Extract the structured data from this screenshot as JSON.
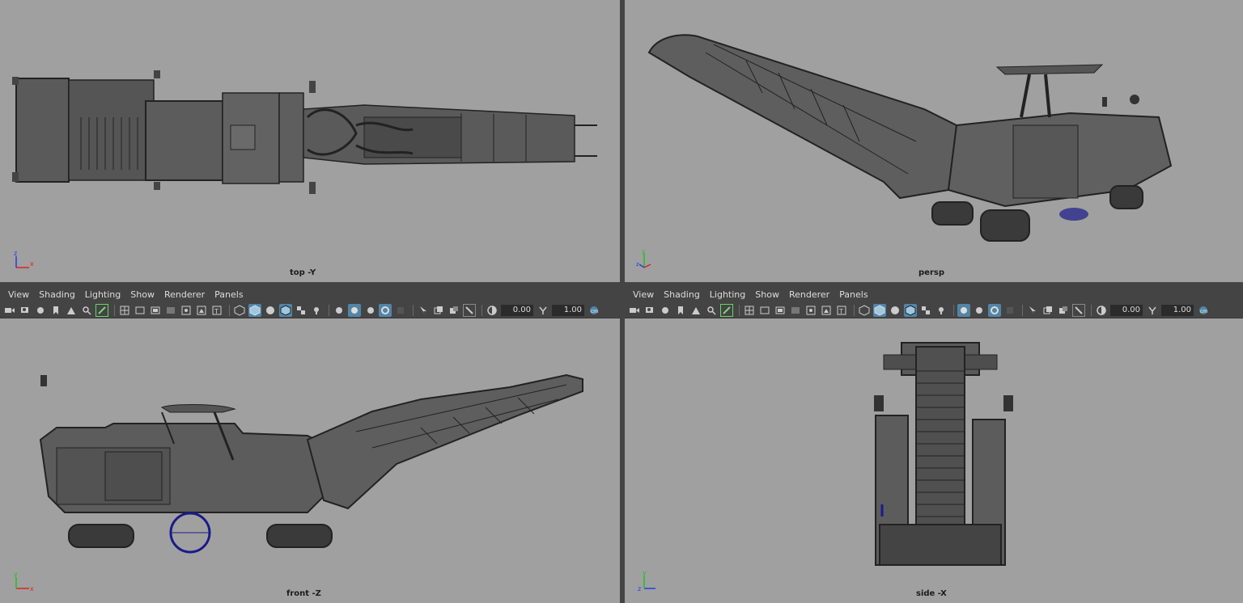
{
  "panels": {
    "top": {
      "label": "top -Y"
    },
    "persp": {
      "label": "persp"
    },
    "front": {
      "label": "front -Z",
      "menu": [
        "View",
        "Shading",
        "Lighting",
        "Show",
        "Renderer",
        "Panels"
      ],
      "field_exposure": "0.00",
      "field_gamma": "1.00"
    },
    "side": {
      "label": "side -X",
      "menu": [
        "View",
        "Shading",
        "Lighting",
        "Show",
        "Renderer",
        "Panels"
      ],
      "field_exposure": "0.00",
      "field_gamma": "1.00"
    }
  },
  "colors": {
    "viewport_bg": "#a0a0a0",
    "chrome_bg": "#444444",
    "active_icon": "#5285a6",
    "axis_x": "#e02020",
    "axis_y": "#20c020",
    "axis_z": "#2040e0",
    "wire": "#222222",
    "mesh": "#5a5a5a",
    "drum": "#1a1a8a"
  }
}
